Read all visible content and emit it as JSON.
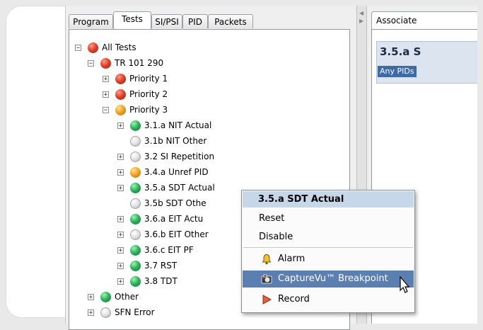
{
  "tabs": [
    "Program",
    "Tests",
    "SI/PSI",
    "PID",
    "Packets"
  ],
  "tree": [
    {
      "label": "All Tests",
      "status": "red",
      "toggle": "−"
    },
    {
      "label": "TR 101 290",
      "status": "red",
      "toggle": "−"
    },
    {
      "label": "Priority 1",
      "status": "red",
      "toggle": "+"
    },
    {
      "label": "Priority 2",
      "status": "red",
      "toggle": "+"
    },
    {
      "label": "Priority 3",
      "status": "orange",
      "toggle": "−"
    },
    {
      "label": "3.1.a NIT Actual",
      "status": "green",
      "toggle": "+"
    },
    {
      "label": "3.1b NIT Other",
      "status": "white",
      "toggle": ""
    },
    {
      "label": "3.2 SI Repetition",
      "status": "white",
      "toggle": "+"
    },
    {
      "label": "3.4.a Unref PID",
      "status": "orange",
      "toggle": "+"
    },
    {
      "label": "3.5.a SDT Actual",
      "status": "green",
      "toggle": "+"
    },
    {
      "label": "3.5b SDT Othe",
      "status": "white",
      "toggle": ""
    },
    {
      "label": "3.6.a EIT Actu",
      "status": "green",
      "toggle": "+"
    },
    {
      "label": "3.6.b EIT Other",
      "status": "white",
      "toggle": "+"
    },
    {
      "label": "3.6.c EIT PF",
      "status": "green",
      "toggle": "+"
    },
    {
      "label": "3.7 RST",
      "status": "green",
      "toggle": "+"
    },
    {
      "label": "3.8 TDT",
      "status": "green",
      "toggle": "+"
    },
    {
      "label": "Other",
      "status": "green",
      "toggle": "+"
    },
    {
      "label": "SFN Error",
      "status": "white",
      "toggle": "+"
    }
  ],
  "right_panel": {
    "tab_label": "Associate",
    "header_title": "3.5.a S",
    "header_sub": "Any PIDs"
  },
  "context_menu": {
    "title": "3.5.a SDT Actual",
    "reset": "Reset",
    "disable": "Disable",
    "alarm": "Alarm",
    "capture": "CaptureVu™ Breakpoint",
    "record": "Record"
  },
  "colors": {
    "menu_highlight": "#5a7fb0",
    "menu_title_bg": "#c6d7ea",
    "selection_bg": "#3e6aa8"
  }
}
